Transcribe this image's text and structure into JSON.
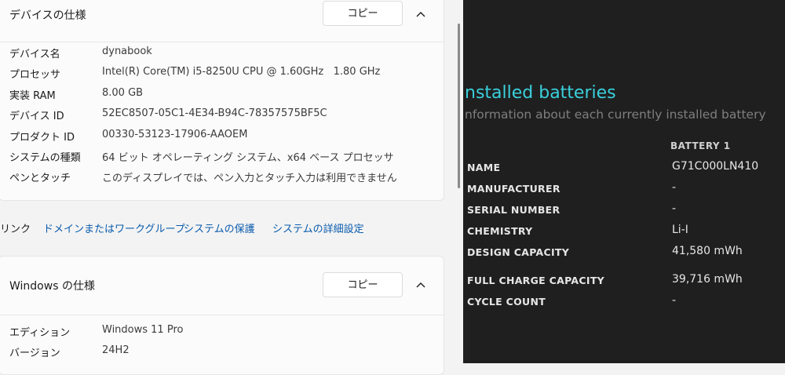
{
  "device_spec": {
    "title": "デバイスの仕様",
    "copy_label": "コピー",
    "rows": [
      {
        "label": "デバイス名",
        "value": "dynabook"
      },
      {
        "label": "プロセッサ",
        "value": "Intel(R) Core(TM) i5-8250U CPU @ 1.60GHz   1.80 GHz"
      },
      {
        "label": "実装 RAM",
        "value": "8.00 GB"
      },
      {
        "label": "デバイス ID",
        "value": "52EC8507-05C1-4E34-B94C-78357575BF5C"
      },
      {
        "label": "プロダクト ID",
        "value": "00330-53123-17906-AAOEM"
      },
      {
        "label": "システムの種類",
        "value": "64 ビット オペレーティング システム、x64 ベース プロセッサ"
      },
      {
        "label": "ペンとタッチ",
        "value": "このディスプレイでは、ペン入力とタッチ入力は利用できません"
      }
    ]
  },
  "related_links": {
    "label": "リンク",
    "links": [
      "ドメインまたはワークグループ",
      "システムの保護",
      "システムの詳細設定"
    ]
  },
  "windows_spec": {
    "title": "Windows の仕様",
    "copy_label": "コピー",
    "rows": [
      {
        "label": "エディション",
        "value": "Windows 11 Pro"
      },
      {
        "label": "バージョン",
        "value": "24H2"
      }
    ]
  },
  "battery_report": {
    "title": "nstalled batteries",
    "subtitle": "nformation about each currently installed battery",
    "column": "BATTERY 1",
    "rows": [
      {
        "label": "NAME",
        "value": "G71C000LN410"
      },
      {
        "label": "MANUFACTURER",
        "value": "-"
      },
      {
        "label": "SERIAL NUMBER",
        "value": "-"
      },
      {
        "label": "CHEMISTRY",
        "value": "Li-I"
      },
      {
        "label": "DESIGN CAPACITY",
        "value": "41,580 mWh"
      },
      {
        "label": "FULL CHARGE CAPACITY",
        "value": "39,716 mWh"
      },
      {
        "label": "CYCLE COUNT",
        "value": "-"
      }
    ]
  },
  "colors": {
    "accent_link": "#0b5cad",
    "battery_title": "#3ad0dc",
    "dark_bg": "#1f1f1f"
  }
}
